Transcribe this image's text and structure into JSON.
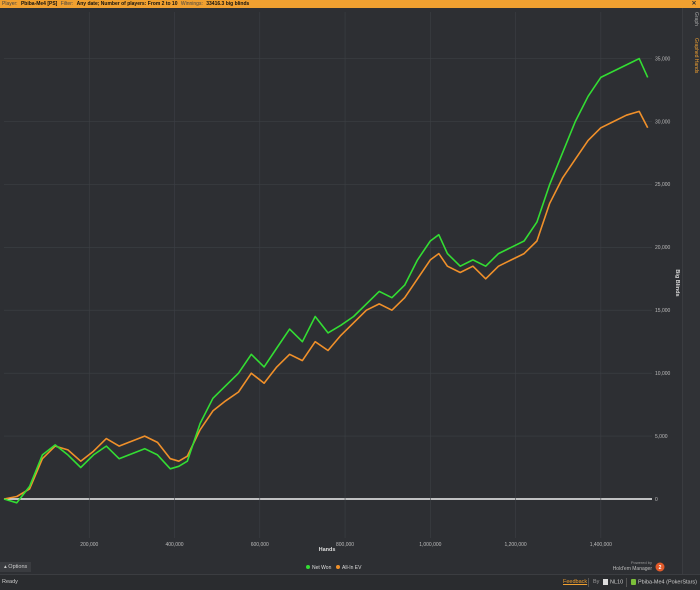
{
  "topbar": {
    "player_label": "Player:",
    "player_value": "Pbiba-Me4 [PS]",
    "filter_label": "Filter:",
    "filter_value": "Any date; Number of players: From 2 to 10",
    "winnings_label": "Winnings:",
    "winnings_value": "33416.3 big blinds",
    "close_icon": "close-icon"
  },
  "sidetabs": {
    "graph": "Graph",
    "graphed_hands": "Graphed Hands"
  },
  "chart_data": {
    "type": "line",
    "xlabel": "Hands",
    "ylabel": "Big Blinds",
    "x_ticks": [
      "200,000",
      "400,000",
      "600,000",
      "800,000",
      "1,000,000",
      "1,200,000",
      "1,400,000"
    ],
    "x_tick_values": [
      200000,
      400000,
      600000,
      800000,
      1000000,
      1200000,
      1400000
    ],
    "y_ticks": [
      "0",
      "5,000",
      "10,000",
      "15,000",
      "20,000",
      "25,000",
      "30,000",
      "35,000"
    ],
    "y_tick_values": [
      0,
      5000,
      10000,
      15000,
      20000,
      25000,
      30000,
      35000
    ],
    "xlim": [
      0,
      1520000
    ],
    "ylim": [
      -3100,
      38700
    ],
    "grid": true,
    "legend_position": "bottom-center",
    "series": [
      {
        "name": "Net Won",
        "color": "#33dd33",
        "x": [
          0,
          30000,
          60000,
          90000,
          120000,
          150000,
          180000,
          210000,
          240000,
          270000,
          300000,
          330000,
          360000,
          390000,
          410000,
          430000,
          460000,
          490000,
          520000,
          550000,
          580000,
          610000,
          640000,
          670000,
          700000,
          730000,
          760000,
          790000,
          820000,
          850000,
          880000,
          910000,
          940000,
          970000,
          1000000,
          1020000,
          1040000,
          1070000,
          1100000,
          1130000,
          1160000,
          1190000,
          1220000,
          1250000,
          1280000,
          1310000,
          1340000,
          1370000,
          1400000,
          1430000,
          1460000,
          1490000,
          1510000
        ],
        "y": [
          0,
          -300,
          1000,
          3500,
          4300,
          3500,
          2500,
          3500,
          4200,
          3200,
          3600,
          4000,
          3500,
          2400,
          2600,
          3000,
          6000,
          8000,
          9000,
          10000,
          11500,
          10500,
          12000,
          13500,
          12500,
          14500,
          13200,
          13800,
          14500,
          15500,
          16500,
          16000,
          17000,
          19000,
          20500,
          21000,
          19500,
          18500,
          19000,
          18500,
          19500,
          20000,
          20500,
          22000,
          25000,
          27500,
          30000,
          32000,
          33500,
          34000,
          34500,
          35000,
          33500
        ]
      },
      {
        "name": "All-In EV",
        "color": "#f0902a",
        "x": [
          0,
          30000,
          60000,
          90000,
          120000,
          150000,
          180000,
          210000,
          240000,
          270000,
          300000,
          330000,
          360000,
          390000,
          410000,
          430000,
          460000,
          490000,
          520000,
          550000,
          580000,
          610000,
          640000,
          670000,
          700000,
          730000,
          760000,
          790000,
          820000,
          850000,
          880000,
          910000,
          940000,
          970000,
          1000000,
          1020000,
          1040000,
          1070000,
          1100000,
          1130000,
          1160000,
          1190000,
          1220000,
          1250000,
          1280000,
          1310000,
          1340000,
          1370000,
          1400000,
          1430000,
          1460000,
          1490000,
          1510000
        ],
        "y": [
          0,
          200,
          800,
          3200,
          4200,
          3900,
          3000,
          3800,
          4800,
          4200,
          4600,
          5000,
          4500,
          3200,
          3000,
          3400,
          5500,
          7000,
          7800,
          8500,
          10000,
          9200,
          10500,
          11500,
          11000,
          12500,
          11800,
          13000,
          14000,
          15000,
          15500,
          15000,
          16000,
          17500,
          19000,
          19500,
          18500,
          18000,
          18500,
          17500,
          18500,
          19000,
          19500,
          20500,
          23500,
          25500,
          27000,
          28500,
          29500,
          30000,
          30500,
          30800,
          29500
        ]
      }
    ],
    "legend": [
      "Net Won",
      "All-In EV"
    ]
  },
  "options_button": "Options",
  "statusbar": {
    "status": "Ready",
    "feedback": "Feedback",
    "by_label": "By",
    "stake": "NL10",
    "player": "Pbiba-Me4 (PokerStars)"
  },
  "branding": {
    "powered_by": "Powered by",
    "name": "Hold'em Manager",
    "version_badge": "2"
  }
}
